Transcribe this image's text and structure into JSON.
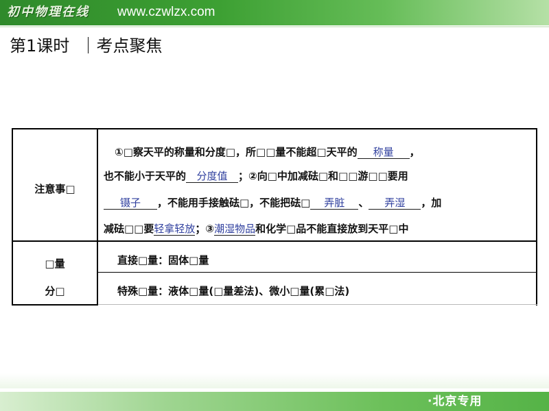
{
  "header": {
    "logo_text": "初中物理在线",
    "url": "www.czwlzx.com"
  },
  "page_title": "第1课时  ｜考点聚焦",
  "table": {
    "row1": {
      "label": "注意事□",
      "lines": [
        {
          "before": "①□察天平的称量和分度□，所□□量不能超□天平的",
          "answer": "称量",
          "after": "，"
        },
        {
          "before": "也不能小于天平的",
          "answer": "分度值",
          "after": "；②向□中加减砝□和□□游□□要用"
        },
        {
          "answer": "镊子",
          "middle": "，不能用手接触砝□，不能把砝□",
          "answer2": "弄脏",
          "sep": "、",
          "answer3": "弄湿",
          "after": "，加"
        },
        {
          "before": "减砝□□要",
          "answer": "轻拿轻放",
          "mid": "；③",
          "answer2": "潮湿物品",
          "after": "和化学□品不能直接放到天平□中"
        }
      ]
    },
    "row2": {
      "label_top": "□量",
      "label_bottom": "分□",
      "line1": "直接□量：固体□量",
      "line2": "特殊□量：液体□量(□量差法)、微小□量(累□法)"
    }
  },
  "footer": {
    "tag": "·北京专用"
  }
}
